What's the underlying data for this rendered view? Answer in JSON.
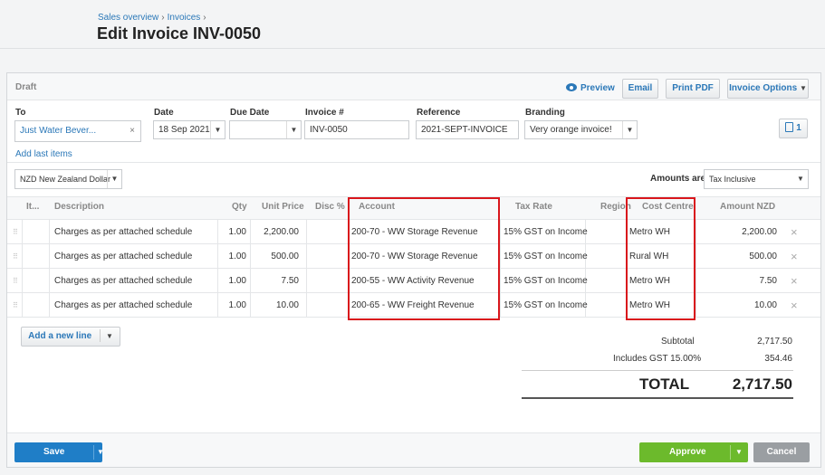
{
  "breadcrumb": [
    "Sales overview",
    "Invoices"
  ],
  "page_title": "Edit Invoice INV-0050",
  "status": "Draft",
  "actions": {
    "preview": "Preview",
    "email": "Email",
    "print_pdf": "Print PDF",
    "invoice_options": "Invoice Options"
  },
  "form": {
    "to_label": "To",
    "to_value": "Just Water Bever...",
    "date_label": "Date",
    "date_value": "18 Sep 2021",
    "due_label": "Due Date",
    "due_value": "",
    "invoice_label": "Invoice #",
    "invoice_value": "INV-0050",
    "reference_label": "Reference",
    "reference_value": "2021-SEPT-INVOICE",
    "branding_label": "Branding",
    "branding_value": "Very orange invoice!",
    "attachments_count": "1",
    "add_last_items": "Add last items"
  },
  "currency": "NZD New Zealand Dollar",
  "amounts_are_label": "Amounts are",
  "amounts_are_value": "Tax Inclusive",
  "columns": {
    "item": "It...",
    "description": "Description",
    "qty": "Qty",
    "unit_price": "Unit Price",
    "disc": "Disc %",
    "account": "Account",
    "tax_rate": "Tax Rate",
    "region": "Region",
    "cost_centre": "Cost Centre",
    "amount": "Amount NZD"
  },
  "rows": [
    {
      "description": "Charges as per attached schedule",
      "qty": "1.00",
      "unit_price": "2,200.00",
      "account": "200-70 - WW Storage Revenue",
      "tax_rate": "15% GST on Income",
      "cost_centre": "Metro WH",
      "amount": "2,200.00"
    },
    {
      "description": "Charges as per attached schedule",
      "qty": "1.00",
      "unit_price": "500.00",
      "account": "200-70 - WW Storage Revenue",
      "tax_rate": "15% GST on Income",
      "cost_centre": "Rural WH",
      "amount": "500.00"
    },
    {
      "description": "Charges as per attached schedule",
      "qty": "1.00",
      "unit_price": "7.50",
      "account": "200-55 - WW Activity Revenue",
      "tax_rate": "15% GST on Income",
      "cost_centre": "Metro WH",
      "amount": "7.50"
    },
    {
      "description": "Charges as per attached schedule",
      "qty": "1.00",
      "unit_price": "10.00",
      "account": "200-65 - WW Freight Revenue",
      "tax_rate": "15% GST on Income",
      "cost_centre": "Metro WH",
      "amount": "10.00"
    }
  ],
  "add_new_line": "Add a new line",
  "totals": {
    "subtotal_label": "Subtotal",
    "subtotal": "2,717.50",
    "gst_label": "Includes GST 15.00%",
    "gst": "354.46",
    "total_label": "TOTAL",
    "total": "2,717.50"
  },
  "footer": {
    "save": "Save",
    "approve": "Approve",
    "cancel": "Cancel"
  },
  "colors": {
    "link": "#2b78b8",
    "save": "#1f7ec7",
    "approve": "#6cba2c",
    "highlight": "#d9161c"
  }
}
